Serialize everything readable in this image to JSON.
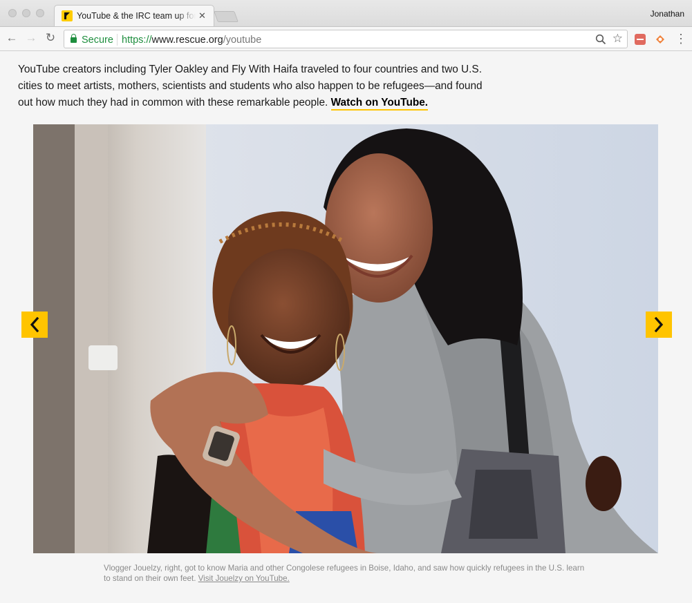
{
  "browser": {
    "tab": {
      "title": "YouTube & the IRC team up for",
      "close_symbol": "✕",
      "favicon": "irc-logo-icon"
    },
    "profile_name": "Jonathan",
    "nav": {
      "back_symbol": "←",
      "forward_symbol": "→",
      "reload_symbol": "↻",
      "menu_symbol": "⋮",
      "star_symbol": "☆"
    },
    "address_bar": {
      "secure_label": "Secure",
      "url_scheme": "https://",
      "url_host": "www.rescue.org",
      "url_path": "/youtube"
    },
    "extensions": [
      "red-extension-icon",
      "orange-extension-icon"
    ]
  },
  "page": {
    "intro_text": "YouTube creators including Tyler Oakley and Fly With Haifa traveled to four countries and two U.S. cities to meet artists, mothers, scientists and students who also happen to be refugees—and found out how much they had in common with these remarkable people.",
    "watch_link": "Watch on YouTube.",
    "carousel": {
      "prev_icon": "chevron-left-icon",
      "next_icon": "chevron-right-icon",
      "image_subject": "two-women-hugging-photo"
    },
    "caption_text": "Vlogger Jouelzy, right, got to know Maria and other Congolese refugees in Boise, Idaho, and saw how quickly refugees in the U.S. learn to stand on their own feet.",
    "caption_link": "Visit Jouelzy on YouTube."
  },
  "colors": {
    "accent_yellow": "#ffc400",
    "secure_green": "#1e8e3e"
  }
}
